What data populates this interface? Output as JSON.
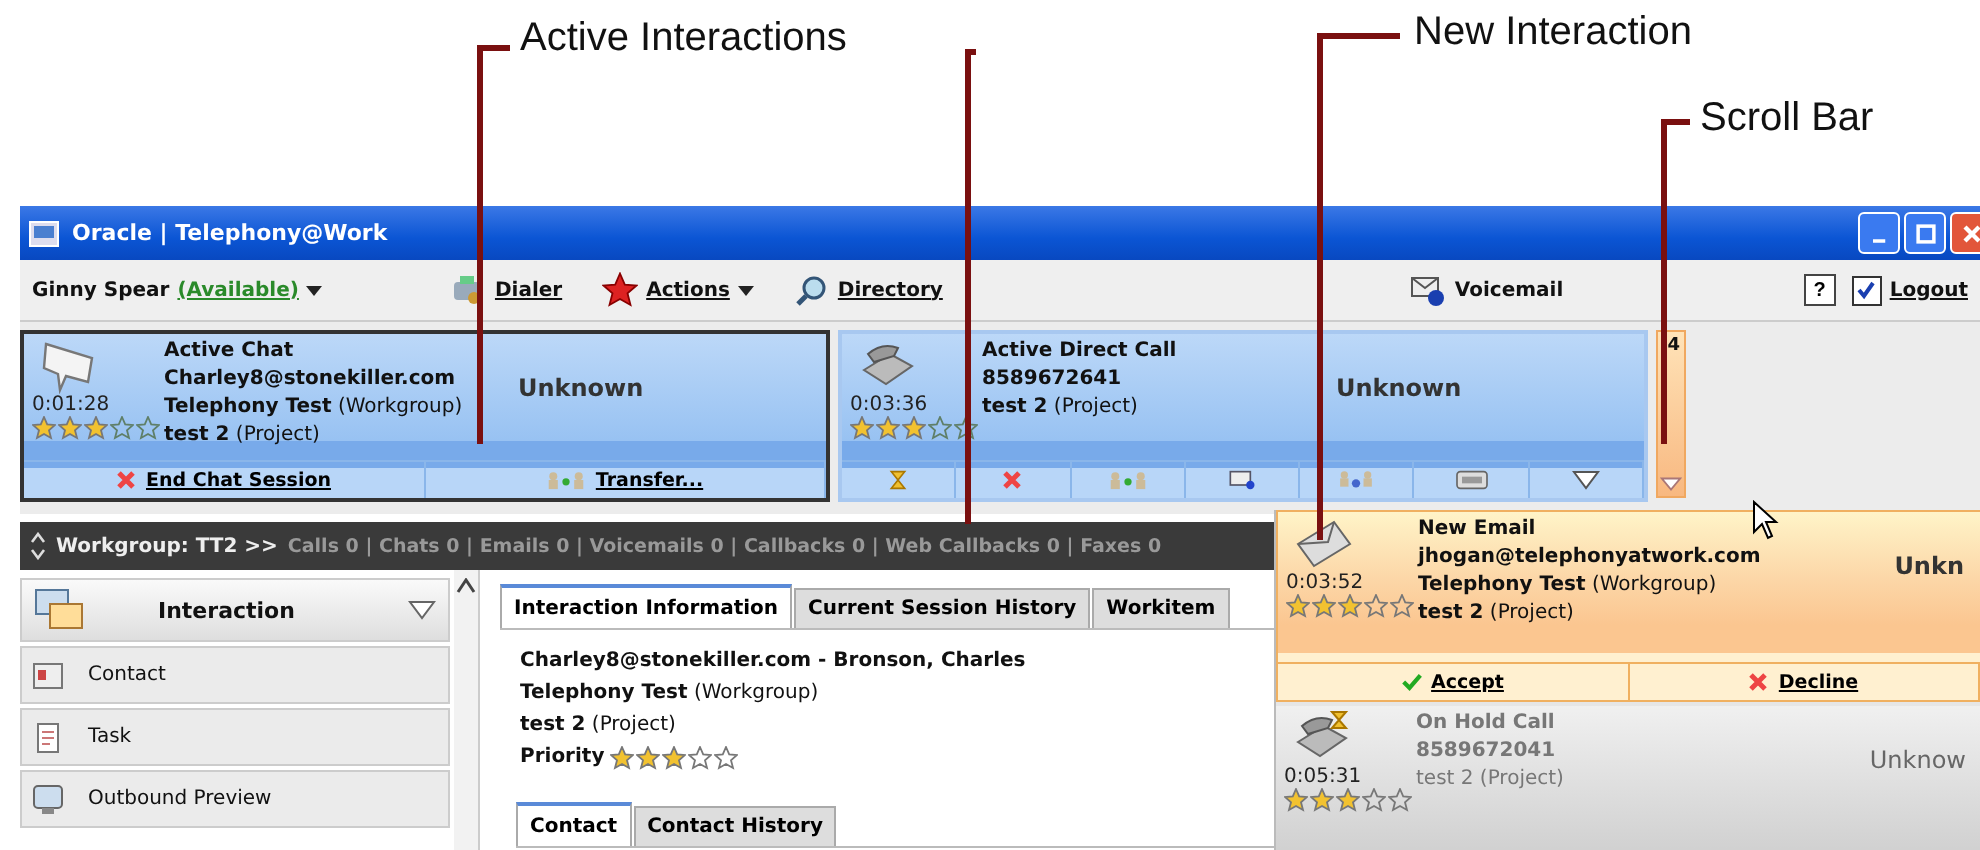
{
  "annotations": [
    {
      "label": "Active Interactions"
    },
    {
      "label": "New Interaction"
    },
    {
      "label": "Scroll Bar"
    }
  ],
  "window": {
    "title": "Oracle | Telephony@Work"
  },
  "toolbar": {
    "agent": "Ginny Spear",
    "status": "(Available)",
    "items": [
      {
        "kind": "dialer",
        "label": "Dialer"
      },
      {
        "kind": "actions",
        "label": "Actions"
      },
      {
        "kind": "directory",
        "label": "Directory"
      }
    ],
    "voicemail": "Voicemail",
    "help": "?",
    "logout": {
      "label": "Logout",
      "checked": true
    }
  },
  "cards": [
    {
      "kind": "chat",
      "selected": true,
      "title": "Active Chat",
      "lines": [
        "Charley8@stonekiller.com",
        "**Telephony Test** (Workgroup)",
        "**test 2** (Project)"
      ],
      "timer": "0:01:28",
      "stars": 3,
      "status": "Unknown",
      "actions": [
        {
          "kind": "end",
          "label": "End Chat Session"
        },
        {
          "kind": "transfer",
          "label": "Transfer..."
        }
      ]
    },
    {
      "kind": "call",
      "selected": false,
      "title": "Active Direct Call",
      "lines": [
        "8589672641",
        "**test 2** (Project)"
      ],
      "timer": "0:03:36",
      "stars": 3,
      "status": "Unknown",
      "actions": [
        {
          "kind": "hold"
        },
        {
          "kind": "end"
        },
        {
          "kind": "transfer"
        },
        {
          "kind": "email"
        },
        {
          "kind": "conference"
        },
        {
          "kind": "keypad"
        },
        {
          "kind": "menu"
        }
      ]
    }
  ],
  "scrollbar": {
    "count": "4"
  },
  "workgroup": {
    "label": "Workgroup: TT2 >>",
    "counters": "Calls 0 | Chats 0 | Emails 0 | Voicemails 0 | Callbacks 0 | Web Callbacks 0 | Faxes 0"
  },
  "sidebar": {
    "header": "Interaction",
    "items": [
      {
        "kind": "contact",
        "label": "Contact"
      },
      {
        "kind": "task",
        "label": "Task"
      },
      {
        "kind": "outbound",
        "label": "Outbound Preview"
      }
    ]
  },
  "tabs": [
    {
      "label": "Interaction Information",
      "selected": true
    },
    {
      "label": "Current Session History",
      "selected": false
    },
    {
      "label": "Workitem",
      "selected": false
    }
  ],
  "details": {
    "lines": [
      "**Charley8@stonekiller.com - Bronson, Charles**",
      "**Telephony Test** (Workgroup)",
      "**test 2** (Project)"
    ],
    "priority_label": "Priority",
    "stars": 3
  },
  "subtabs": [
    {
      "label": "Contact",
      "selected": true
    },
    {
      "label": "Contact History",
      "selected": false
    }
  ],
  "popup": [
    {
      "kind": "email",
      "title": "New Email",
      "lines": [
        "jhogan@telephonyatwork.com",
        "**Telephony Test** (Workgroup)",
        "**test 2** (Project)"
      ],
      "timer": "0:03:52",
      "stars": 3,
      "status": "Unkn",
      "actions": [
        {
          "kind": "accept",
          "label": "Accept"
        },
        {
          "kind": "decline",
          "label": "Decline"
        }
      ]
    },
    {
      "kind": "hold",
      "title": "On Hold Call",
      "lines": [
        "8589672041",
        "test 2 (Project)"
      ],
      "timer": "0:05:31",
      "stars": 3,
      "status": "Unknow"
    }
  ]
}
